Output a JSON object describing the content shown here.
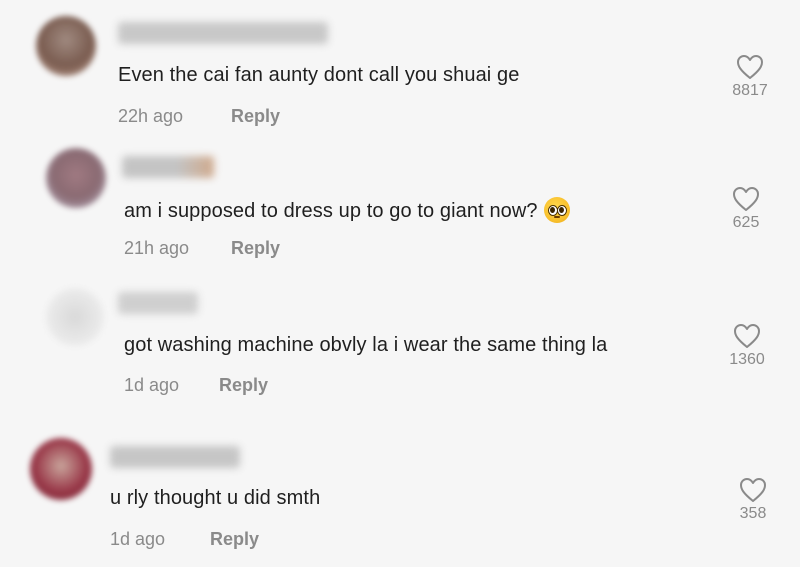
{
  "colors": {
    "background": "#f6f6f6",
    "text": "#1f1f1f",
    "muted": "#8a8a8a"
  },
  "comments": [
    {
      "text": "Even the cai fan aunty dont call you shuai ge",
      "time": "22h ago",
      "reply_label": "Reply",
      "likes": "8817",
      "has_emoji": false
    },
    {
      "text": "am i supposed to dress up to go to giant now?",
      "time": "21h ago",
      "reply_label": "Reply",
      "likes": "625",
      "has_emoji": true,
      "emoji": "pleading-face"
    },
    {
      "text": "got washing machine obvly la i wear the same thing la",
      "time": "1d ago",
      "reply_label": "Reply",
      "likes": "1360",
      "has_emoji": false
    },
    {
      "text": "u rly thought u did smth",
      "time": "1d ago",
      "reply_label": "Reply",
      "likes": "358",
      "has_emoji": false
    }
  ],
  "icons": {
    "like": "heart-outline-icon"
  }
}
